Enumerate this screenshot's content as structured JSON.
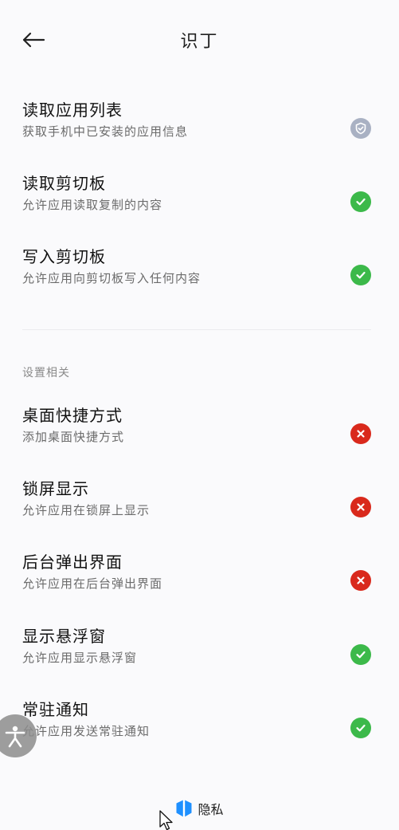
{
  "header": {
    "title": "识丁"
  },
  "permissions": [
    {
      "title": "读取应用列表",
      "desc": "获取手机中已安装的应用信息",
      "status": "readonly"
    },
    {
      "title": "读取剪切板",
      "desc": "允许应用读取复制的内容",
      "status": "on"
    },
    {
      "title": "写入剪切板",
      "desc": "允许应用向剪切板写入任何内容",
      "status": "on"
    }
  ],
  "settings_section": {
    "label": "设置相关",
    "items": [
      {
        "title": "桌面快捷方式",
        "desc": "添加桌面快捷方式",
        "status": "off"
      },
      {
        "title": "锁屏显示",
        "desc": "允许应用在锁屏上显示",
        "status": "off"
      },
      {
        "title": "后台弹出界面",
        "desc": "允许应用在后台弹出界面",
        "status": "off"
      },
      {
        "title": "显示悬浮窗",
        "desc": "允许应用显示悬浮窗",
        "status": "on"
      },
      {
        "title": "常驻通知",
        "desc": "允许应用发送常驻通知",
        "status": "on"
      }
    ]
  },
  "footer": {
    "label": "隐私",
    "icon": "privacy-shield-icon"
  },
  "colors": {
    "on": "#3cb94a",
    "off": "#d9291c",
    "readonly": "#a9b1c3",
    "footer_icon": "#1e90ff"
  }
}
